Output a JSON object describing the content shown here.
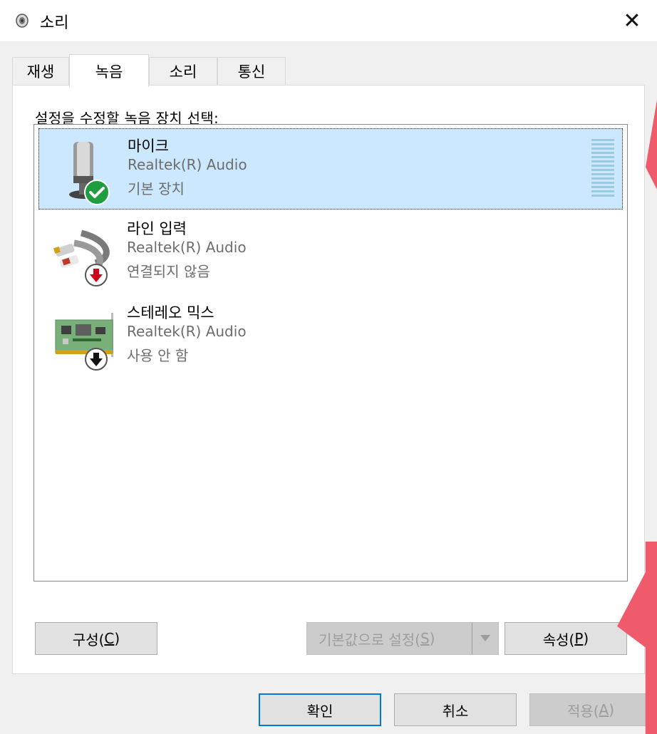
{
  "window": {
    "title": "소리",
    "close_symbol": "✕",
    "title_icon": "speaker-icon"
  },
  "tabs": [
    {
      "label": "재생",
      "active": false
    },
    {
      "label": "녹음",
      "active": true
    },
    {
      "label": "소리",
      "active": false
    },
    {
      "label": "통신",
      "active": false
    }
  ],
  "instruction": "설정을 수정할 녹음 장치 선택:",
  "devices": [
    {
      "name": "마이크",
      "driver": "Realtek(R) Audio",
      "status": "기본 장치",
      "selected": true,
      "icon": "microphone-icon",
      "badge": "default-checkmark-icon"
    },
    {
      "name": "라인 입력",
      "driver": "Realtek(R) Audio",
      "status": "연결되지 않음",
      "selected": false,
      "icon": "line-in-cable-icon",
      "badge": "unplugged-arrow-icon"
    },
    {
      "name": "스테레오 믹스",
      "driver": "Realtek(R) Audio",
      "status": "사용 안 함",
      "selected": false,
      "icon": "sound-card-icon",
      "badge": "disabled-arrow-icon"
    }
  ],
  "buttons": {
    "configure": {
      "label": "구성(",
      "key": "C",
      "suffix": ")"
    },
    "set_default": {
      "label": "기본값으로 설정(",
      "key": "S",
      "suffix": ")",
      "disabled": true
    },
    "properties": {
      "label": "속성(",
      "key": "P",
      "suffix": ")"
    },
    "ok": "확인",
    "cancel": "취소",
    "apply": {
      "label": "적용(",
      "key": "A",
      "suffix": ")",
      "disabled": true
    }
  },
  "colors": {
    "selection": "#cce8ff",
    "accent": "#0078d7",
    "callout": "#ef5b6b",
    "default_badge": "#1e9e3f",
    "unplugged_badge": "#d0021b"
  }
}
